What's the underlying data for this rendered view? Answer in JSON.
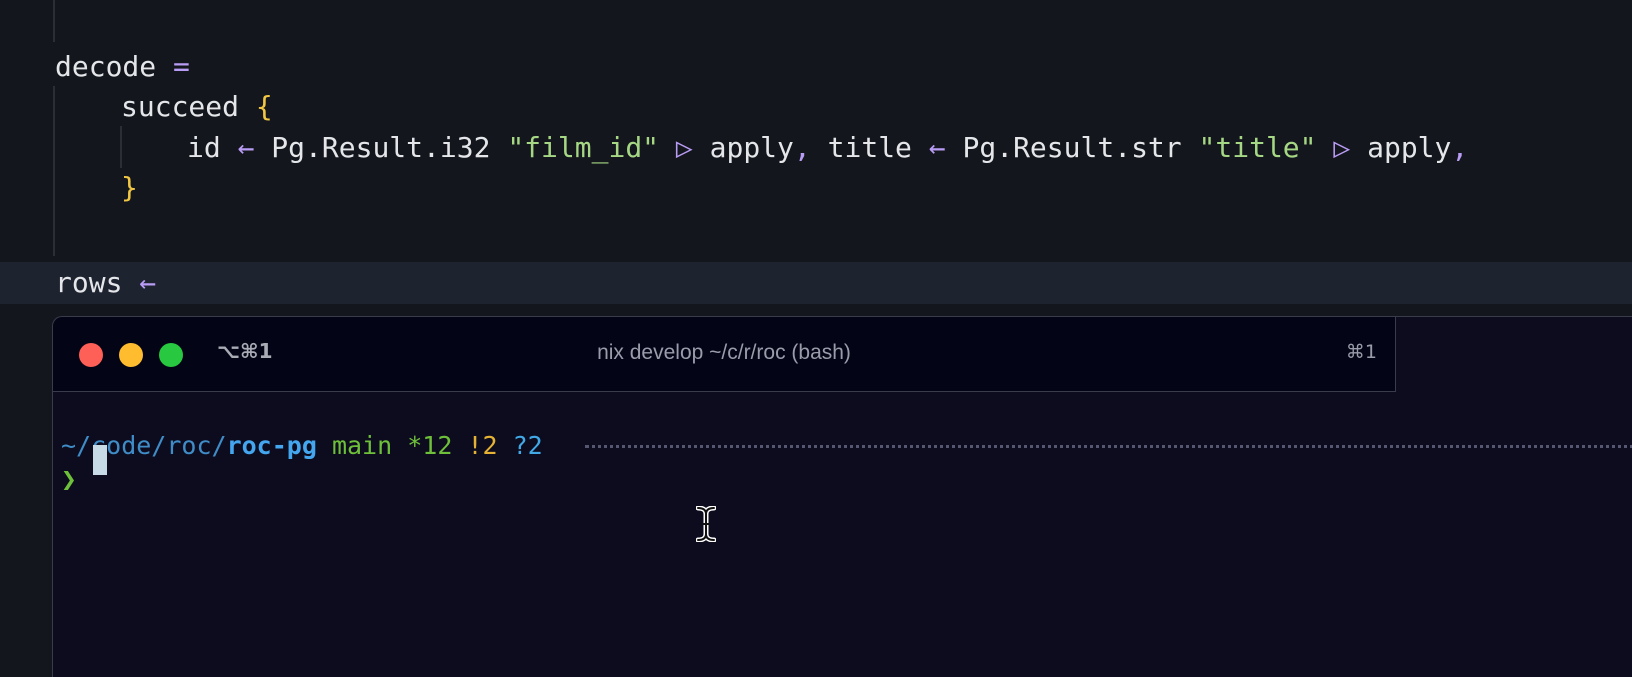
{
  "editor": {
    "line_decode_name": "decode",
    "line_decode_op": "=",
    "line_succeed_name": "succeed",
    "line_succeed_brace": "{",
    "record": {
      "f1": "id",
      "arrow1": "←",
      "call1": "Pg.Result.i32",
      "str1": "\"film_id\"",
      "pipe1": "▷",
      "apply1": "apply",
      "comma1": ",",
      "f2": "title",
      "arrow2": "←",
      "call2": "Pg.Result.str",
      "str2": "\"title\"",
      "pipe2": "▷",
      "apply2": "apply",
      "comma2": ","
    },
    "line_close_brace": "}",
    "line_rows_name": "rows",
    "line_rows_op": "←"
  },
  "terminal": {
    "shortcut_left": "⌥⌘1",
    "title": "nix develop ~/c/r/roc (bash)",
    "shortcut_right": "⌘1",
    "prompt": {
      "path_prefix": "~/code/roc/",
      "path_current": "roc-pg",
      "branch": "main",
      "dirty": "*12",
      "modified": "!2",
      "untracked": "?2",
      "symbol": "❯"
    }
  },
  "colors": {
    "editor_bg": "#13161c",
    "terminal_bg": "#0d0c1f",
    "operator": "#b99cf5",
    "brace": "#f2c744",
    "string": "#a6d784"
  }
}
